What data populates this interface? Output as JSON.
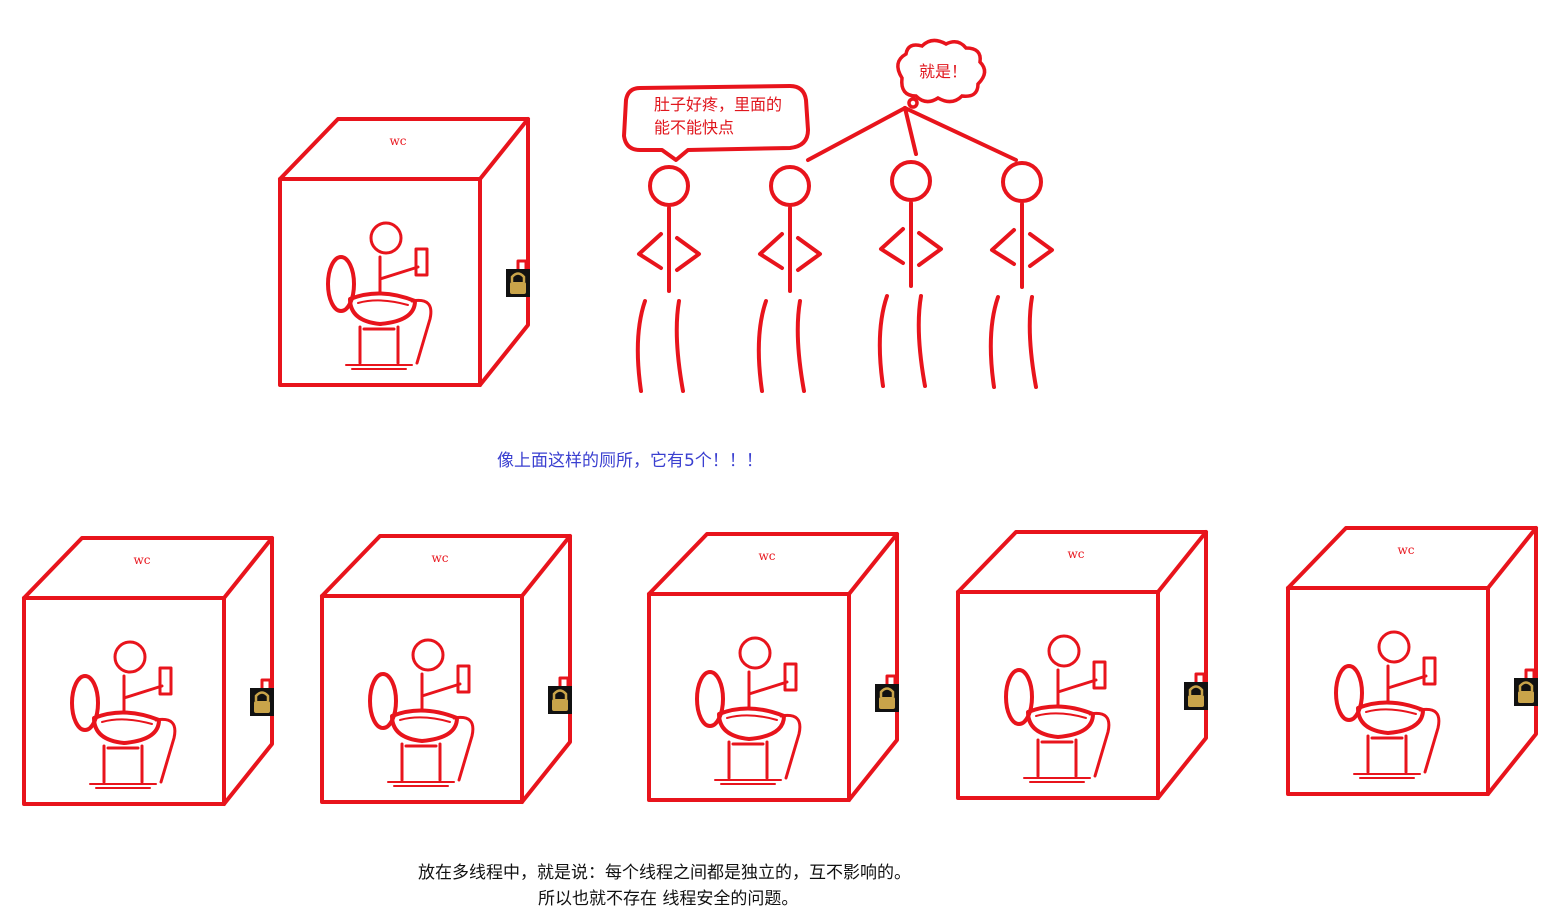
{
  "stall_label": "wc",
  "speech": {
    "waiting_person": "肚子好疼，里面的能不能快点",
    "waiting_person_line1": "肚子好疼，里面的",
    "waiting_person_line2": "能不能快点",
    "agree": "就是！"
  },
  "captions": {
    "top": "像上面这样的厕所，它有5个！！！",
    "bottom_line1": "放在多线程中，就是说：每个线程之间都是独立的，互不影响的。",
    "bottom_line2": "所以也就不存在  线程安全的问题。"
  },
  "counts": {
    "bottom_stalls": 5,
    "waiting_people": 4
  },
  "colors": {
    "stroke": "#e8141c",
    "caption_top": "#3a3fd0",
    "caption_bottom": "#111111",
    "lock_bg": "#111111",
    "lock_body": "#c9a44a"
  }
}
